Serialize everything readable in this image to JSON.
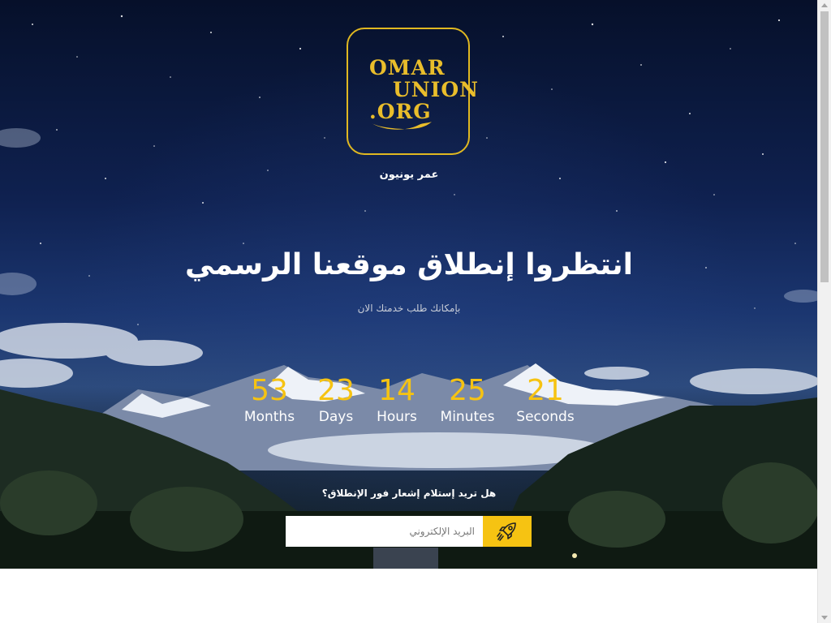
{
  "logo": {
    "line1": "OMAR",
    "line2": "UNION",
    "line3": ".ORG"
  },
  "brand_caption": "عمر يونيون",
  "headline": "انتظروا إنطلاق موقعنا الرسمي",
  "subline": "بإمكانك طلب خدمتك الان",
  "countdown": [
    {
      "value": "53",
      "label": "Months"
    },
    {
      "value": "23",
      "label": "Days"
    },
    {
      "value": "14",
      "label": "Hours"
    },
    {
      "value": "25",
      "label": "Minutes"
    },
    {
      "value": "21",
      "label": "Seconds"
    }
  ],
  "notify": {
    "question": "هل تريد إستلام إشعار فور الإنطلاق؟",
    "email_placeholder": "البريد الإلكتروني",
    "submit_icon": "rocket-icon"
  },
  "colors": {
    "accent": "#f6c312",
    "logo_gold": "#e0b821",
    "sky_dark": "#0f2150"
  }
}
